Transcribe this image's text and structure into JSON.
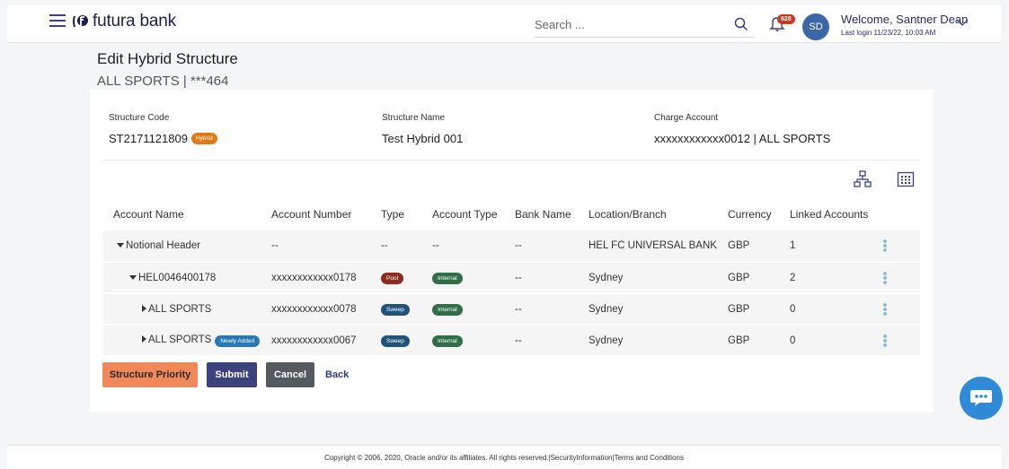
{
  "header": {
    "brand": "futura bank",
    "search_placeholder": "Search ...",
    "notification_count": "628",
    "avatar_initials": "SD",
    "welcome": "Welcome, Santner Dean",
    "last_login": "Last login 11/23/22, 10:03 AM"
  },
  "page": {
    "title": "Edit Hybrid Structure",
    "subtitle": "ALL SPORTS | ***464"
  },
  "structure": {
    "code_label": "Structure Code",
    "code_value": "ST2171121809",
    "code_tag": "Hybrid",
    "name_label": "Structure Name",
    "name_value": "Test Hybrid 001",
    "charge_label": "Charge Account",
    "charge_value": "xxxxxxxxxxxx0012 | ALL SPORTS"
  },
  "table": {
    "columns": [
      "Account Name",
      "Account Number",
      "Type",
      "Account Type",
      "Bank Name",
      "Location/Branch",
      "Currency",
      "Linked Accounts"
    ],
    "rows": [
      {
        "name": "Notional Header",
        "caret": "down",
        "indent": 0,
        "number": "--",
        "type": "--",
        "account_type": "--",
        "bank": "--",
        "location": "HEL FC UNIVERSAL BANK",
        "currency": "GBP",
        "linked": "1"
      },
      {
        "name": "HEL0046400178",
        "caret": "down",
        "indent": 1,
        "number": "xxxxxxxxxxxx0178",
        "type": "Pool",
        "account_type": "Internal",
        "bank": "--",
        "location": "Sydney",
        "currency": "GBP",
        "linked": "2"
      },
      {
        "name": "ALL SPORTS",
        "caret": "right",
        "indent": 2,
        "number": "xxxxxxxxxxxx0078",
        "type": "Sweep",
        "account_type": "Internal",
        "bank": "--",
        "location": "Sydney",
        "currency": "GBP",
        "linked": "0"
      },
      {
        "name": "ALL SPORTS",
        "caret": "right",
        "indent": 2,
        "new_tag": "Newly Added",
        "number": "xxxxxxxxxxxx0067",
        "type": "Sweep",
        "account_type": "Internal",
        "bank": "--",
        "location": "Sydney",
        "currency": "GBP",
        "linked": "0"
      }
    ]
  },
  "actions": {
    "priority": "Structure Priority",
    "submit": "Submit",
    "cancel": "Cancel",
    "back": "Back"
  },
  "footer": {
    "text": "Copyright © 2006, 2020, Oracle and/or its affiliates. All rights reserved.|SecurityInformation|Terms and Conditions"
  },
  "icons": {
    "menu": "hamburger-icon",
    "search": "search-icon",
    "notifications": "bell-icon",
    "chevron": "chevron-down-icon",
    "tree_view": "hierarchy-icon",
    "grid_view": "grid-icon",
    "row_actions": "kebab-icon",
    "chat": "chat-icon"
  },
  "colors": {
    "brand": "#3a3f8f",
    "hybrid_tag": "#e07a14",
    "pool_tag": "#8b2d1d",
    "sweep_tag": "#22527a",
    "internal_tag": "#2f6e48",
    "new_tag": "#2679b4",
    "priority_button": "#f1885a",
    "submit_button": "#3d427f",
    "cancel_button": "#545a5f",
    "chat": "#2f8bd8"
  }
}
